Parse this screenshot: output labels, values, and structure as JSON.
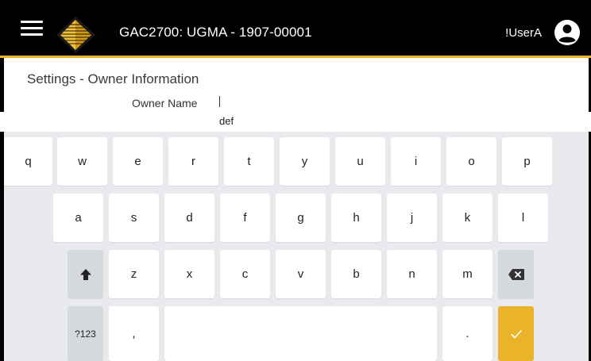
{
  "header": {
    "title": "GAC2700: UGMA - 1907-00001",
    "user": "!UserA",
    "accent_color": "#e8b328",
    "icons": {
      "menu": "hamburger-menu-icon",
      "logo": "gac-logo-icon",
      "account": "account-circle-icon"
    }
  },
  "page": {
    "heading": "Settings - Owner Information"
  },
  "form": {
    "owner_name_label": "Owner Name",
    "owner_name_value": ""
  },
  "suggestion": "def",
  "keyboard": {
    "row1": [
      "q",
      "w",
      "e",
      "r",
      "t",
      "y",
      "u",
      "i",
      "o",
      "p"
    ],
    "row2": [
      "a",
      "s",
      "d",
      "f",
      "g",
      "h",
      "j",
      "k",
      "l"
    ],
    "row3": [
      "z",
      "x",
      "c",
      "v",
      "b",
      "n",
      "m"
    ],
    "symbols_label": "?123",
    "comma": ",",
    "period": ".",
    "icons": {
      "shift": "shift-arrow-icon",
      "backspace": "backspace-icon",
      "enter": "checkmark-icon"
    }
  }
}
